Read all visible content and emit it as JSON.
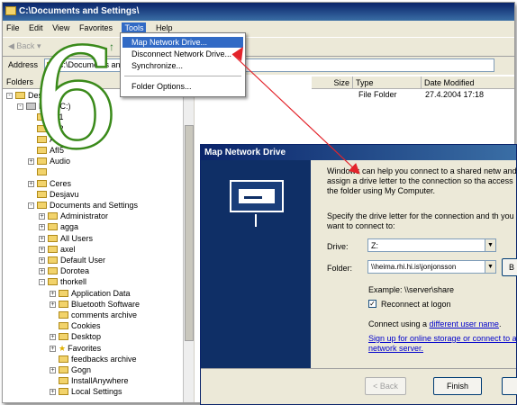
{
  "window": {
    "title": "C:\\Documents and Settings\\"
  },
  "menubar": {
    "items": [
      "File",
      "Edit",
      "View",
      "Favorites",
      "Tools",
      "Help"
    ]
  },
  "toolbar": {
    "back_label": "Back",
    "up_arrow": "↑"
  },
  "address": {
    "label": "Address",
    "value": "C:\\Documents and Settings"
  },
  "folders_pane": {
    "header": "Folders"
  },
  "tree": {
    "items": [
      {
        "label": "Desktop",
        "level": 0,
        "type": "computer",
        "exp": "-"
      },
      {
        "label": "DD1 (C:)",
        "level": 1,
        "type": "drive",
        "exp": "-"
      },
      {
        "label": "Afi1",
        "level": 2,
        "type": "folder",
        "exp": ""
      },
      {
        "label": "Afi2",
        "level": 2,
        "type": "folder",
        "exp": ""
      },
      {
        "label": "Afi4",
        "level": 2,
        "type": "folder",
        "exp": ""
      },
      {
        "label": "AfI5",
        "level": 2,
        "type": "folder",
        "exp": ""
      },
      {
        "label": "Audio",
        "level": 2,
        "type": "folder",
        "exp": "+"
      },
      {
        "label": "",
        "level": 2,
        "type": "folder",
        "exp": ""
      },
      {
        "label": "Ceres",
        "level": 2,
        "type": "folder",
        "exp": "+"
      },
      {
        "label": "Desjavu",
        "level": 2,
        "type": "folder",
        "exp": ""
      },
      {
        "label": "Documents and Settings",
        "level": 2,
        "type": "folder",
        "exp": "-"
      },
      {
        "label": "Administrator",
        "level": 3,
        "type": "folder",
        "exp": "+"
      },
      {
        "label": "agga",
        "level": 3,
        "type": "folder",
        "exp": "+"
      },
      {
        "label": "All Users",
        "level": 3,
        "type": "folder",
        "exp": "+"
      },
      {
        "label": "axel",
        "level": 3,
        "type": "folder",
        "exp": "+"
      },
      {
        "label": "Default User",
        "level": 3,
        "type": "folder",
        "exp": "+"
      },
      {
        "label": "Dorotea",
        "level": 3,
        "type": "folder",
        "exp": "+"
      },
      {
        "label": "thorkell",
        "level": 3,
        "type": "folder",
        "exp": "-"
      },
      {
        "label": "Application Data",
        "level": 4,
        "type": "folder",
        "exp": "+"
      },
      {
        "label": "Bluetooth Software",
        "level": 4,
        "type": "folder",
        "exp": "+"
      },
      {
        "label": "comments archive",
        "level": 4,
        "type": "folder",
        "exp": ""
      },
      {
        "label": "Cookies",
        "level": 4,
        "type": "folder",
        "exp": ""
      },
      {
        "label": "Desktop",
        "level": 4,
        "type": "folder",
        "exp": "+"
      },
      {
        "label": "Favorites",
        "level": 4,
        "type": "star",
        "exp": "+"
      },
      {
        "label": "feedbacks archive",
        "level": 4,
        "type": "folder",
        "exp": ""
      },
      {
        "label": "Gogn",
        "level": 4,
        "type": "folder",
        "exp": "+"
      },
      {
        "label": "InstallAnywhere",
        "level": 4,
        "type": "folder",
        "exp": ""
      },
      {
        "label": "Local Settings",
        "level": 4,
        "type": "folder",
        "exp": "+"
      }
    ]
  },
  "files": {
    "columns": {
      "size": "Size",
      "type": "Type",
      "date": "Date Modified"
    },
    "row": {
      "type": "File Folder",
      "date": "27.4.2004 17:18"
    }
  },
  "tools_menu": {
    "items": [
      "Map Network Drive...",
      "Disconnect Network Drive...",
      "Synchronize...",
      "Folder Options..."
    ]
  },
  "dialog": {
    "title": "Map Network Drive",
    "intro": "Windows can help you connect to a shared netw and assign a drive letter to the connection so tha access the folder using My Computer.",
    "specify": "Specify the drive letter for the connection and th you want to connect to:",
    "drive_label": "Drive:",
    "drive_value": "Z:",
    "folder_label": "Folder:",
    "folder_value": "\\\\heima.rhi.hi.is\\jonjonsson",
    "browse_label": "B",
    "example": "Example: \\\\server\\share",
    "reconnect": "Reconnect at logon",
    "connect_prefix": "Connect using a ",
    "connect_link": "different user name",
    "connect_suffix": ".",
    "signup_link": "Sign up for online storage or connect to a network server.",
    "back_button": "< Back",
    "finish_button": "Finish"
  },
  "overlay": {
    "digit": "6"
  },
  "colors": {
    "accent": "#316ac5",
    "annotation": "#e3242b",
    "digit_fill": "#ffffff",
    "digit_stroke": "#3a8a1a"
  }
}
